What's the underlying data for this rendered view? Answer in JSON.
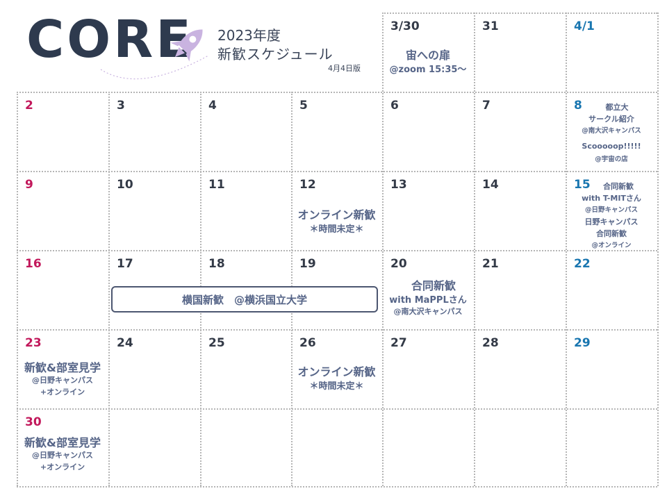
{
  "header": {
    "logo": "CORE",
    "year": "2023年度",
    "title": "新歓スケジュール",
    "edition": "4月4日版"
  },
  "days": {
    "d330": "3/30",
    "d31": "31",
    "d41": "4/1",
    "d2": "2",
    "d3": "3",
    "d4": "4",
    "d5": "5",
    "d6": "6",
    "d7": "7",
    "d8": "8",
    "d9": "9",
    "d10": "10",
    "d11": "11",
    "d12": "12",
    "d13": "13",
    "d14": "14",
    "d15": "15",
    "d16": "16",
    "d17": "17",
    "d18": "18",
    "d19": "19",
    "d20": "20",
    "d21": "21",
    "d22": "22",
    "d23": "23",
    "d24": "24",
    "d25": "25",
    "d26": "26",
    "d27": "27",
    "d28": "28",
    "d29": "29",
    "d30": "30"
  },
  "events": {
    "e330_title": "宙への扉",
    "e330_detail": "@zoom 15:35～",
    "e8_line1": "都立大",
    "e8_line2": "サークル紹介",
    "e8_place": "@南大沢キャンパス",
    "e8_line3": "Scooooop!!!!!",
    "e8_place2": "@宇宙の店",
    "e12_title": "オンライン新歓",
    "e12_note": "＊時間未定＊",
    "e15_line1": "合同新歓",
    "e15_line2": "with T-MITさん",
    "e15_place": "@日野キャンパス",
    "e15_line3": "日野キャンパス",
    "e15_line4": "合同新歓",
    "e15_place2": "@オンライン",
    "banner": "横国新歓　@横浜国立大学",
    "e20_title": "合同新歓",
    "e20_with": "with MaPPLさん",
    "e20_place": "@南大沢キャンパス",
    "e23_title": "新歓&部室見学",
    "e23_place": "@日野キャンパス",
    "e23_plus": "+オンライン",
    "e26_title": "オンライン新歓",
    "e26_note": "＊時間未定＊",
    "e30_title": "新歓&部室見学",
    "e30_place": "@日野キャンパス",
    "e30_plus": "+オンライン"
  },
  "colors": {
    "sunday": "#c2185b",
    "saturday": "#1976b0",
    "event_text": "#556487",
    "rocket": "#c9b3e0"
  }
}
